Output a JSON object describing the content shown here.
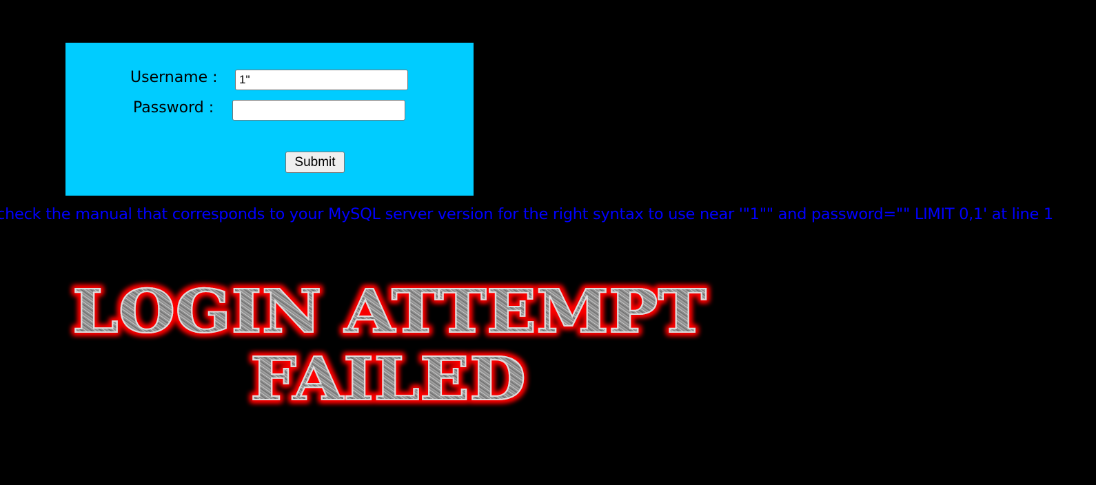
{
  "login": {
    "username_label": "Username :",
    "password_label": "Password :",
    "username_value": "1\"",
    "password_value": "",
    "submit_label": "Submit"
  },
  "error": {
    "message": "check the manual that corresponds to your MySQL server version for the right syntax to use near '\"1\"\" and password=\"\" LIMIT 0,1' at line 1"
  },
  "banner": {
    "line1": "LOGIN ATTEMPT",
    "line2": "FAILED"
  },
  "colors": {
    "page_background": "#000000",
    "panel_background": "#00ccff",
    "error_text": "#0000ff",
    "banner_glow": "#ff0000",
    "banner_fill": "#9a9a9a"
  }
}
